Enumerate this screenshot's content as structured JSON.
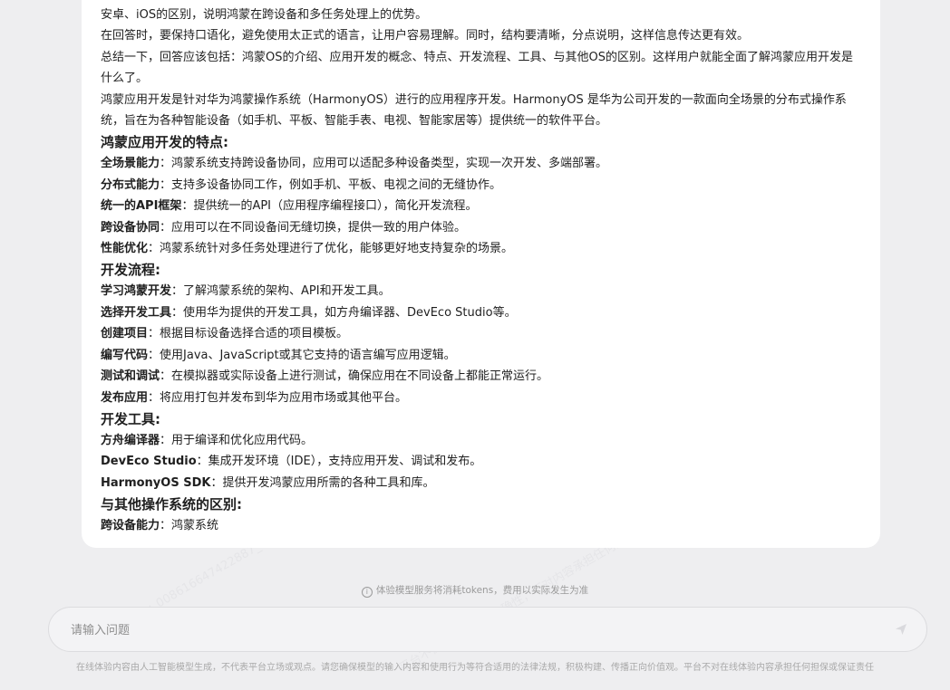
{
  "message": {
    "paragraphs_top": [
      "安卓、iOS的区别，说明鸿蒙在跨设备和多任务处理上的优势。",
      "在回答时，要保持口语化，避免使用太正式的语言，让用户容易理解。同时，结构要清晰，分点说明，这样信息传达更有效。",
      "总结一下，回答应该包括：鸿蒙OS的介绍、应用开发的概念、特点、开发流程、工具、与其他OS的区别。这样用户就能全面了解鸿蒙应用开发是什么了。",
      "鸿蒙应用开发是针对华为鸿蒙操作系统（HarmonyOS）进行的应用程序开发。HarmonyOS 是华为公司开发的一款面向全场景的分布式操作系统，旨在为各种智能设备（如手机、平板、智能手表、电视、智能家居等）提供统一的软件平台。"
    ],
    "sections": [
      {
        "heading": "鸿蒙应用开发的特点:",
        "items": [
          {
            "label": "全场景能力",
            "text": "：鸿蒙系统支持跨设备协同，应用可以适配多种设备类型，实现一次开发、多端部署。"
          },
          {
            "label": "分布式能力",
            "text": "：支持多设备协同工作，例如手机、平板、电视之间的无缝协作。"
          },
          {
            "label": "统一的API框架",
            "text": "：提供统一的API（应用程序编程接口），简化开发流程。"
          },
          {
            "label": "跨设备协同",
            "text": "：应用可以在不同设备间无缝切换，提供一致的用户体验。"
          },
          {
            "label": "性能优化",
            "text": "：鸿蒙系统针对多任务处理进行了优化，能够更好地支持复杂的场景。"
          }
        ]
      },
      {
        "heading": "开发流程:",
        "items": [
          {
            "label": "学习鸿蒙开发",
            "text": "：了解鸿蒙系统的架构、API和开发工具。"
          },
          {
            "label": "选择开发工具",
            "text": "：使用华为提供的开发工具，如方舟编译器、DevEco Studio等。"
          },
          {
            "label": "创建项目",
            "text": "：根据目标设备选择合适的项目模板。"
          },
          {
            "label": "编写代码",
            "text": "：使用Java、JavaScript或其它支持的语言编写应用逻辑。"
          },
          {
            "label": "测试和调试",
            "text": "：在模拟器或实际设备上进行测试，确保应用在不同设备上都能正常运行。"
          },
          {
            "label": "发布应用",
            "text": "：将应用打包并发布到华为应用市场或其他平台。"
          }
        ]
      },
      {
        "heading": "开发工具:",
        "items": [
          {
            "label": "方舟编译器",
            "text": "：用于编译和优化应用代码。"
          },
          {
            "label": "DevEco Studio",
            "text": "：集成开发环境（IDE），支持应用开发、调试和发布。"
          },
          {
            "label": "HarmonyOS SDK",
            "text": "：提供开发鸿蒙应用所需的各种工具和库。"
          }
        ]
      },
      {
        "heading": "与其他操作系统的区别:",
        "items": [
          {
            "label": "跨设备能力",
            "text": "：鸿蒙系统"
          }
        ]
      }
    ]
  },
  "notice": "体验模型服务将消耗tokens，费用以实际发生为准",
  "input": {
    "placeholder": "请输入问题",
    "value": ""
  },
  "send_icon": "send-arrow-icon",
  "footer": "在线体验内容由人工智能模型生成，不代表平台立场或观点。请您确保模型的输入内容和使用行为等符合适用的法律法规，积极构建、传播正向价值观。平台不对在线体验内容承担任何担保或保证责任",
  "watermark": [
    "hw_008616647422887_01",
    "内容由AI生成，不代表平台立场",
    "平台不保证其真实、准确性，不对内容承担任何的责任"
  ]
}
